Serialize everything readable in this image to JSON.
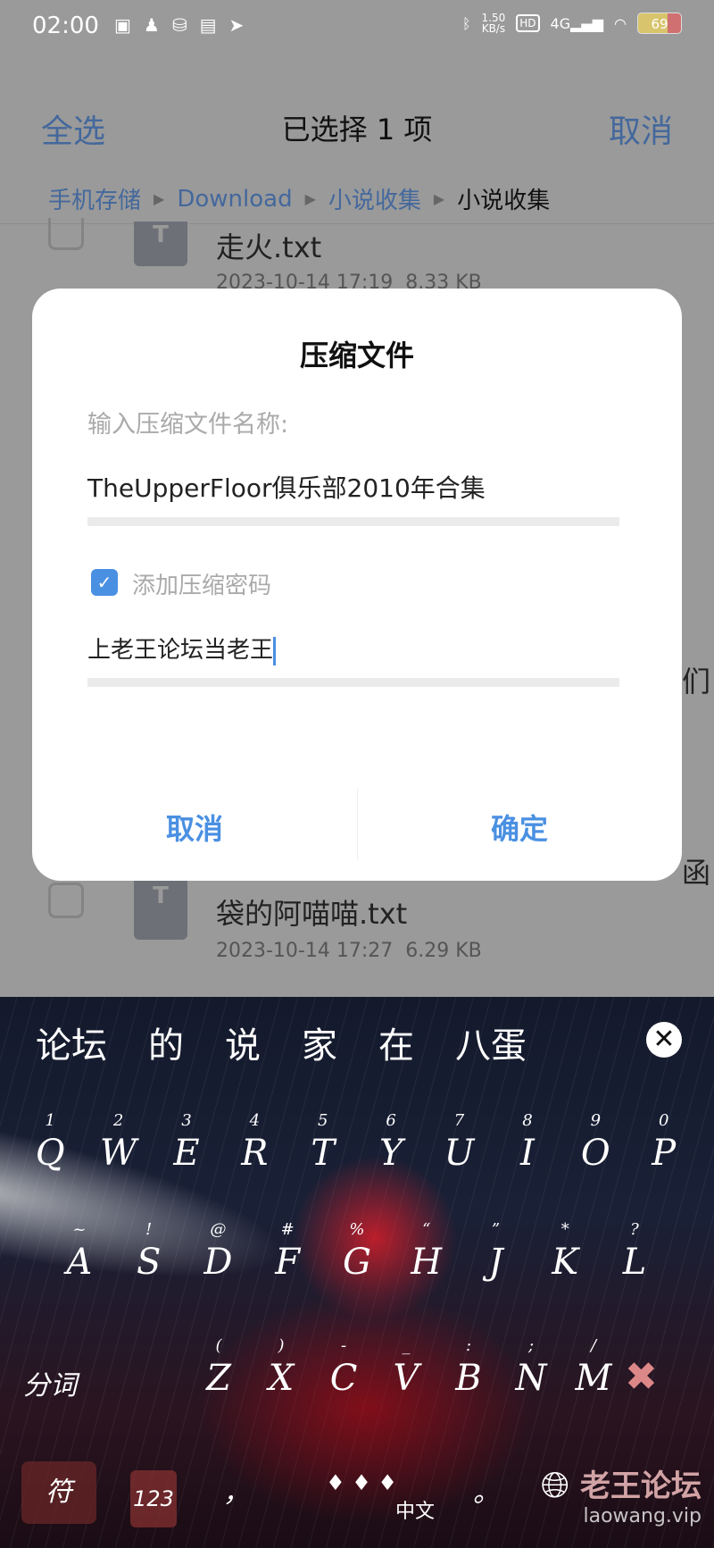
{
  "status_bar": {
    "time": "02:00",
    "net_speed": "1.50",
    "net_unit": "KB/s",
    "hd": "HD",
    "network": "4G",
    "battery": "69",
    "battery_percent": 69
  },
  "header": {
    "select_all": "全选",
    "title": "已选择 1 项",
    "cancel": "取消"
  },
  "breadcrumb": [
    "手机存储",
    "Download",
    "小说收集",
    "小说收集"
  ],
  "files": [
    {
      "name": "走火.txt",
      "date": "2023-10-14 17:19",
      "size": "8.33 KB"
    },
    {
      "name": "袋的阿喵喵.txt",
      "date": "2023-10-14 17:27",
      "size": "6.29 KB"
    }
  ],
  "partial_right_chars": [
    "们",
    "函"
  ],
  "dialog": {
    "title": "压缩文件",
    "label": "输入压缩文件名称:",
    "filename": "TheUpperFloor俱乐部2010年合集",
    "password_checkbox": "添加压缩密码",
    "password_checked": true,
    "password": "上老王论坛当老王",
    "cancel": "取消",
    "confirm": "确定"
  },
  "keyboard": {
    "candidates": [
      "论坛",
      "的",
      "说",
      "家",
      "在",
      "八蛋"
    ],
    "row1": [
      [
        "1",
        "Q"
      ],
      [
        "2",
        "W"
      ],
      [
        "3",
        "E"
      ],
      [
        "4",
        "R"
      ],
      [
        "5",
        "T"
      ],
      [
        "6",
        "Y"
      ],
      [
        "7",
        "U"
      ],
      [
        "8",
        "I"
      ],
      [
        "9",
        "O"
      ],
      [
        "0",
        "P"
      ]
    ],
    "row2": [
      [
        "~",
        "A"
      ],
      [
        "!",
        "S"
      ],
      [
        "@",
        "D"
      ],
      [
        "#",
        "F"
      ],
      [
        "%",
        "G"
      ],
      [
        "“",
        "H"
      ],
      [
        "”",
        "J"
      ],
      [
        "*",
        "K"
      ],
      [
        "?",
        "L"
      ]
    ],
    "row3": [
      [
        "(",
        "Z"
      ],
      [
        ")",
        "X"
      ],
      [
        "-",
        "C"
      ],
      [
        "_",
        "V"
      ],
      [
        ":",
        "B"
      ],
      [
        ";",
        "N"
      ],
      [
        "/",
        "M"
      ]
    ],
    "segment_key": "分词",
    "symbol_key": "符",
    "number_key": "123",
    "comma": "，",
    "space_label": "中文",
    "period": "。",
    "watermark": "老王论坛",
    "watermark_url": "laowang.vip"
  },
  "colors": {
    "accent": "#4a90e2",
    "header_link": "#44689c"
  }
}
